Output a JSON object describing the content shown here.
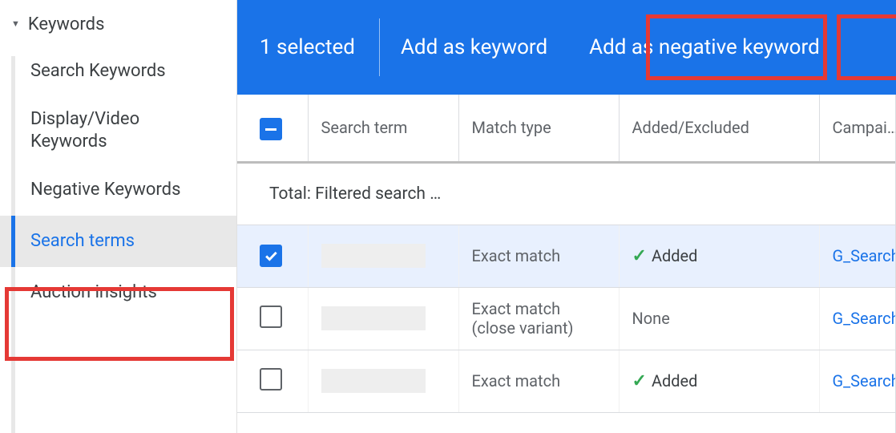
{
  "sidebar": {
    "group_label": "Keywords",
    "items": [
      {
        "label": "Search Keywords",
        "active": false
      },
      {
        "label": "Display/Video Keywords",
        "active": false
      },
      {
        "label": "Negative Keywords",
        "active": false
      },
      {
        "label": "Search terms",
        "active": true
      },
      {
        "label": "Auction insights",
        "active": false
      }
    ]
  },
  "action_bar": {
    "selected_text": "1 selected",
    "add_keyword_label": "Add as keyword",
    "add_negative_label": "Add as negative keyword"
  },
  "table": {
    "headers": {
      "search_term": "Search term",
      "match_type": "Match type",
      "added_excluded": "Added/Excluded",
      "campaign": "Campaign"
    },
    "total_row_label": "Total: Filtered search …",
    "rows": [
      {
        "checked": true,
        "search_term": "",
        "match_type": "Exact match",
        "added_excluded": "Added",
        "added_status": "added",
        "campaign": "G_Search"
      },
      {
        "checked": false,
        "search_term": "",
        "match_type": "Exact match (close variant)",
        "added_excluded": "None",
        "added_status": "none",
        "campaign": "G_Search"
      },
      {
        "checked": false,
        "search_term": "",
        "match_type": "Exact match",
        "added_excluded": "Added",
        "added_status": "added",
        "campaign": "G_Search"
      }
    ]
  }
}
